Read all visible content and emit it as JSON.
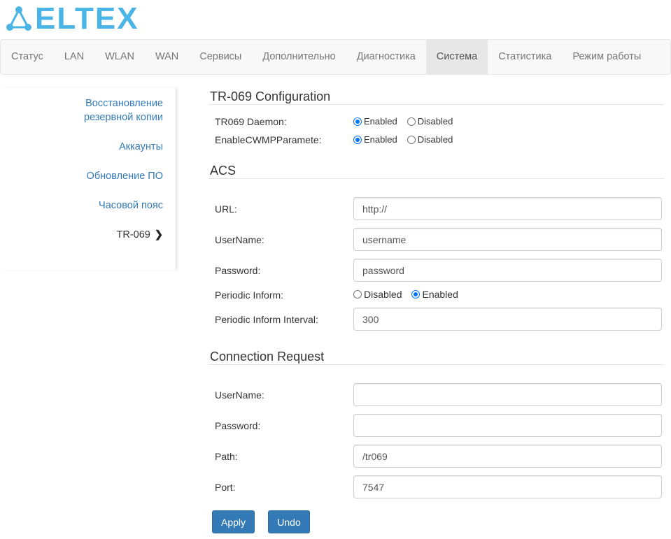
{
  "brand": {
    "logo_text": "ELTEX",
    "accent": "#4ab4e6"
  },
  "nav": {
    "items": [
      "Статус",
      "LAN",
      "WLAN",
      "WAN",
      "Сервисы",
      "Дополнительно",
      "Диагностика",
      "Система",
      "Статистика",
      "Режим работы"
    ],
    "active": "Система"
  },
  "sidebar": {
    "items": [
      {
        "label": "Восстановление резервной копии"
      },
      {
        "label": "Аккаунты"
      },
      {
        "label": "Обновление ПО"
      },
      {
        "label": "Часовой пояс"
      },
      {
        "label": "TR-069",
        "active": true
      }
    ]
  },
  "tr069": {
    "title": "TR-069 Configuration",
    "daemon_label": "TR069 Daemon:",
    "cwmp_label": "EnableCWMPParamete:",
    "enabled": "Enabled",
    "disabled": "Disabled",
    "daemon_value": "Enabled",
    "cwmp_value": "Enabled"
  },
  "acs": {
    "title": "ACS",
    "url_label": "URL:",
    "url_value": "http://",
    "username_label": "UserName:",
    "username_value": "username",
    "password_label": "Password:",
    "password_value": "password",
    "periodic_label": "Periodic Inform:",
    "periodic_disabled": "Disabled",
    "periodic_enabled": "Enabled",
    "periodic_value": "Enabled",
    "interval_label": "Periodic Inform Interval:",
    "interval_value": "300"
  },
  "conn": {
    "title": "Connection Request",
    "username_label": "UserName:",
    "username_value": "",
    "password_label": "Password:",
    "password_value": "",
    "path_label": "Path:",
    "path_value": "/tr069",
    "port_label": "Port:",
    "port_value": "7547"
  },
  "buttons": {
    "apply": "Apply",
    "undo": "Undo"
  }
}
